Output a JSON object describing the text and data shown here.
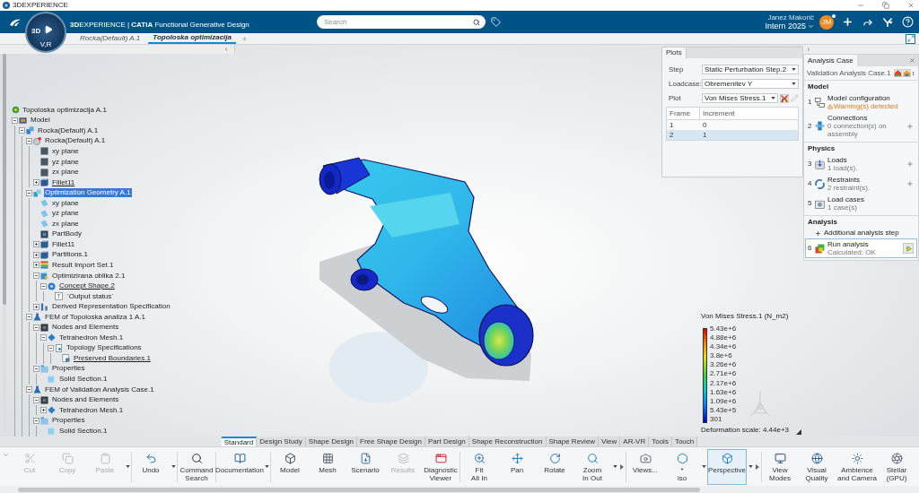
{
  "window": {
    "title": "3DEXPERIENCE"
  },
  "header": {
    "brand": "**3D**EXPERIENCE | **CATIA** Functional Generative Design",
    "compass": {
      "left": "3D",
      "bottom": "V,R"
    },
    "search": {
      "placeholder": "Search"
    },
    "user": {
      "name": "Janez Makorič",
      "initials": "JM",
      "workspace": "Intern 2025"
    }
  },
  "doc_tabs": [
    {
      "label": "Rocka(Default) A.1",
      "selected": false
    },
    {
      "label": "Topoloska optimizacija",
      "selected": true
    }
  ],
  "tree": {
    "items": [
      {
        "label": "Topoloska optimizacija A.1",
        "kind": "analysis",
        "selected": false,
        "underlined": false,
        "children": [
          {
            "label": "Model",
            "kind": "model",
            "selected": false,
            "underlined": false,
            "expanded": true,
            "children": [
              {
                "label": "Rocka(Default) A.1",
                "kind": "product",
                "selected": false,
                "underlined": false,
                "expanded": true,
                "children": [
                  {
                    "label": "Rocka(Default) A.1",
                    "kind": "part",
                    "selected": false,
                    "underlined": false,
                    "expanded": true,
                    "children": [
                      {
                        "label": "xy plane",
                        "kind": "plane",
                        "selected": false,
                        "underlined": false
                      },
                      {
                        "label": "yz plane",
                        "kind": "plane",
                        "selected": false,
                        "underlined": false
                      },
                      {
                        "label": "zx plane",
                        "kind": "plane",
                        "selected": false,
                        "underlined": false
                      },
                      {
                        "label": "Fillet11",
                        "kind": "feature",
                        "selected": false,
                        "underlined": true,
                        "expanded": false
                      }
                    ]
                  },
                  {
                    "label": "Optimization Geometry A.1",
                    "kind": "geometry",
                    "selected": true,
                    "underlined": false,
                    "expanded": true,
                    "children": [
                      {
                        "label": "xy plane",
                        "kind": "surface",
                        "selected": false,
                        "underlined": false
                      },
                      {
                        "label": "yz plane",
                        "kind": "surface",
                        "selected": false,
                        "underlined": false
                      },
                      {
                        "label": "zx plane",
                        "kind": "surface",
                        "selected": false,
                        "underlined": false
                      },
                      {
                        "label": "PartBody",
                        "kind": "body",
                        "selected": false,
                        "underlined": false
                      },
                      {
                        "label": "Fillet11",
                        "kind": "feature",
                        "selected": false,
                        "underlined": false,
                        "expanded": false
                      },
                      {
                        "label": "Partitions.1",
                        "kind": "feature",
                        "selected": false,
                        "underlined": false,
                        "expanded": false
                      },
                      {
                        "label": "Result Import Set.1",
                        "kind": "results",
                        "selected": false,
                        "underlined": false,
                        "expanded": false
                      },
                      {
                        "label": "Optimizirana oblika 2.1",
                        "kind": "shape",
                        "selected": false,
                        "underlined": false,
                        "expanded": true,
                        "children": [
                          {
                            "label": "Concept Shape.2",
                            "kind": "concept",
                            "selected": false,
                            "underlined": true,
                            "expanded": true,
                            "children": [
                              {
                                "label": "`Output status`",
                                "kind": "parameter",
                                "selected": false,
                                "underlined": false
                              }
                            ]
                          }
                        ]
                      },
                      {
                        "label": "Derived Representation Specification",
                        "kind": "spec",
                        "selected": false,
                        "underlined": false,
                        "expanded": false
                      }
                    ]
                  },
                  {
                    "label": "FEM of Topoloska analiza 1 A.1",
                    "kind": "fem",
                    "selected": false,
                    "underlined": false,
                    "expanded": true,
                    "children": [
                      {
                        "label": "Nodes and Elements",
                        "kind": "nodes",
                        "selected": false,
                        "underlined": false,
                        "expanded": true,
                        "children": [
                          {
                            "label": "Tetrahedron Mesh.1",
                            "kind": "mesh",
                            "selected": false,
                            "underlined": false,
                            "expanded": true,
                            "children": [
                              {
                                "label": "Topology Specifications",
                                "kind": "topology",
                                "selected": false,
                                "underlined": false,
                                "expanded": true,
                                "children": [
                                  {
                                    "label": "Preserved Boundaries.1",
                                    "kind": "boundary",
                                    "selected": false,
                                    "underlined": true
                                  }
                                ]
                              }
                            ]
                          }
                        ]
                      },
                      {
                        "label": "Properties",
                        "kind": "properties",
                        "selected": false,
                        "underlined": false,
                        "expanded": true,
                        "children": [
                          {
                            "label": "Solid Section.1",
                            "kind": "section",
                            "selected": false,
                            "underlined": false
                          }
                        ]
                      }
                    ]
                  },
                  {
                    "label": "FEM of Validation Analysis Case.1",
                    "kind": "fem",
                    "selected": false,
                    "underlined": false,
                    "expanded": true,
                    "children": [
                      {
                        "label": "Nodes and Elements",
                        "kind": "nodes",
                        "selected": false,
                        "underlined": false,
                        "expanded": true,
                        "children": [
                          {
                            "label": "Tetrahedron Mesh.1",
                            "kind": "mesh",
                            "selected": false,
                            "underlined": false,
                            "expanded": false
                          }
                        ]
                      },
                      {
                        "label": "Properties",
                        "kind": "properties",
                        "selected": false,
                        "underlined": false,
                        "expanded": true,
                        "children": [
                          {
                            "label": "Solid Section.1",
                            "kind": "section",
                            "selected": false,
                            "underlined": false
                          }
                        ]
                      }
                    ]
                  }
                ]
              }
            ]
          }
        ]
      }
    ]
  },
  "plots": {
    "tab": "Plots",
    "fields": [
      {
        "label": "Step",
        "value": "Static Perturbation Step.2",
        "kind": "select"
      },
      {
        "label": "Loadcase:",
        "value": "Obremenitev Y",
        "kind": "select"
      },
      {
        "label": "Plot",
        "value": "Von Mises Stress.1",
        "kind": "plot"
      }
    ],
    "table": {
      "columns": [
        "Frame",
        "Increment"
      ],
      "rows": [
        {
          "cells": [
            "1",
            "0"
          ],
          "selected": false
        },
        {
          "cells": [
            "2",
            "1"
          ],
          "selected": true
        }
      ]
    }
  },
  "legend": {
    "title": "Von Mises Stress.1 (N_m2)",
    "labels": [
      "5.43e+6",
      "4.88e+6",
      "4.34e+6",
      "3.8e+6",
      "3.26e+6",
      "2.71e+6",
      "2.17e+6",
      "1.63e+6",
      "1.09e+6",
      "5.43e+5",
      "301"
    ],
    "deformation": "Deformation scale: 4.44e+3"
  },
  "analysis": {
    "tab": "Analysis Case",
    "case": "Validation Analysis Case.1",
    "sections": [
      {
        "title": "Model",
        "items": [
          {
            "number": "1",
            "title": "Model configuration",
            "status": "Warning(s) detected",
            "kind": "config",
            "warning": true,
            "add_button": false,
            "run_button": false,
            "selected": false
          },
          {
            "number": "2",
            "title": "Connections",
            "status": "0 connection(s) on assembly",
            "kind": "connections",
            "warning": false,
            "add_button": true,
            "run_button": false,
            "selected": false
          }
        ]
      },
      {
        "title": "Physics",
        "items": [
          {
            "number": "3",
            "title": "Loads",
            "status": "1 load(s).",
            "kind": "loads",
            "warning": false,
            "add_button": true,
            "run_button": false,
            "selected": false
          },
          {
            "number": "4",
            "title": "Restraints",
            "status": "2 restraint(s).",
            "kind": "restraints",
            "warning": false,
            "add_button": true,
            "run_button": false,
            "selected": false
          },
          {
            "number": "5",
            "title": "Load cases",
            "status": "1 case(s)",
            "kind": "cases",
            "warning": false,
            "add_button": false,
            "run_button": false,
            "selected": false
          }
        ]
      },
      {
        "title": "Analysis",
        "add_step": "Additional analysis step",
        "items": [
          {
            "number": "6",
            "title": "Run analysis",
            "status": "Calculated: OK",
            "kind": "run",
            "warning": false,
            "add_button": false,
            "run_button": true,
            "selected": true
          }
        ]
      }
    ]
  },
  "toolbar_tabs": [
    {
      "label": "Standard",
      "selected": true
    },
    {
      "label": "Design Study",
      "selected": false
    },
    {
      "label": "Shape Design",
      "selected": false
    },
    {
      "label": "Free Shape Design",
      "selected": false
    },
    {
      "label": "Part Design",
      "selected": false
    },
    {
      "label": "Shape Reconstruction",
      "selected": false
    },
    {
      "label": "Shape Review",
      "selected": false
    },
    {
      "label": "View",
      "selected": false
    },
    {
      "label": "AR-VR",
      "selected": false
    },
    {
      "label": "Tools",
      "selected": false
    },
    {
      "label": "Touch",
      "selected": false
    }
  ],
  "toolbar": {
    "groups": [
      {
        "more": false,
        "tools": [
          {
            "label": "Cut",
            "kind": "cut",
            "disabled": true,
            "selected": false,
            "dropdown": false
          },
          {
            "label": "Copy",
            "kind": "copy",
            "disabled": true,
            "selected": false,
            "dropdown": false
          },
          {
            "label": "Paste",
            "kind": "paste",
            "disabled": true,
            "selected": false,
            "dropdown": true
          }
        ]
      },
      {
        "more": false,
        "tools": [
          {
            "label": "Undo",
            "kind": "undo",
            "disabled": false,
            "selected": false,
            "dropdown": true
          }
        ]
      },
      {
        "more": false,
        "tools": [
          {
            "label": "Command\nSearch",
            "kind": "search",
            "disabled": false,
            "selected": false,
            "dropdown": false
          }
        ]
      },
      {
        "more": false,
        "tools": [
          {
            "label": "Documentation",
            "kind": "book",
            "disabled": false,
            "selected": false,
            "dropdown": true
          }
        ]
      },
      {
        "more": false,
        "tools": [
          {
            "label": "Model",
            "kind": "model",
            "disabled": false,
            "selected": false,
            "dropdown": false
          },
          {
            "label": "Mesh",
            "kind": "mesh",
            "disabled": false,
            "selected": false,
            "dropdown": false
          },
          {
            "label": "Scenario",
            "kind": "scenario",
            "disabled": false,
            "selected": false,
            "dropdown": false
          },
          {
            "label": "Results",
            "kind": "results",
            "disabled": true,
            "selected": false,
            "dropdown": false
          },
          {
            "label": "Diagnostic\nViewer",
            "kind": "diagnostic",
            "disabled": false,
            "selected": false,
            "dropdown": false
          }
        ]
      },
      {
        "more": true,
        "tools": [
          {
            "label": "Fit\nAll In",
            "kind": "fit",
            "disabled": false,
            "selected": false,
            "dropdown": false
          },
          {
            "label": "Pan",
            "kind": "pan",
            "disabled": false,
            "selected": false,
            "dropdown": false
          },
          {
            "label": "Rotate",
            "kind": "rotate",
            "disabled": false,
            "selected": false,
            "dropdown": false
          },
          {
            "label": "Zoom\nIn Out",
            "kind": "zoom",
            "disabled": false,
            "selected": false,
            "dropdown": true
          }
        ]
      },
      {
        "more": true,
        "tools": [
          {
            "label": "Views...",
            "kind": "camera",
            "disabled": false,
            "selected": false,
            "dropdown": false
          },
          {
            "label": "*\niso",
            "kind": "iso",
            "disabled": false,
            "selected": false,
            "dropdown": true
          },
          {
            "label": "Perspective",
            "kind": "perspective",
            "disabled": false,
            "selected": true,
            "dropdown": true
          }
        ]
      },
      {
        "more": false,
        "tools": [
          {
            "label": "View\nModes",
            "kind": "modes",
            "disabled": false,
            "selected": false,
            "dropdown": false
          },
          {
            "label": "Visual\nQuality",
            "kind": "quality",
            "disabled": false,
            "selected": false,
            "dropdown": false
          },
          {
            "label": "Ambience\nand Camera",
            "kind": "ambience",
            "disabled": false,
            "selected": false,
            "dropdown": false
          },
          {
            "label": "Stellar\n(GPU)",
            "kind": "stellar",
            "disabled": false,
            "selected": false,
            "dropdown": false
          }
        ]
      }
    ]
  }
}
